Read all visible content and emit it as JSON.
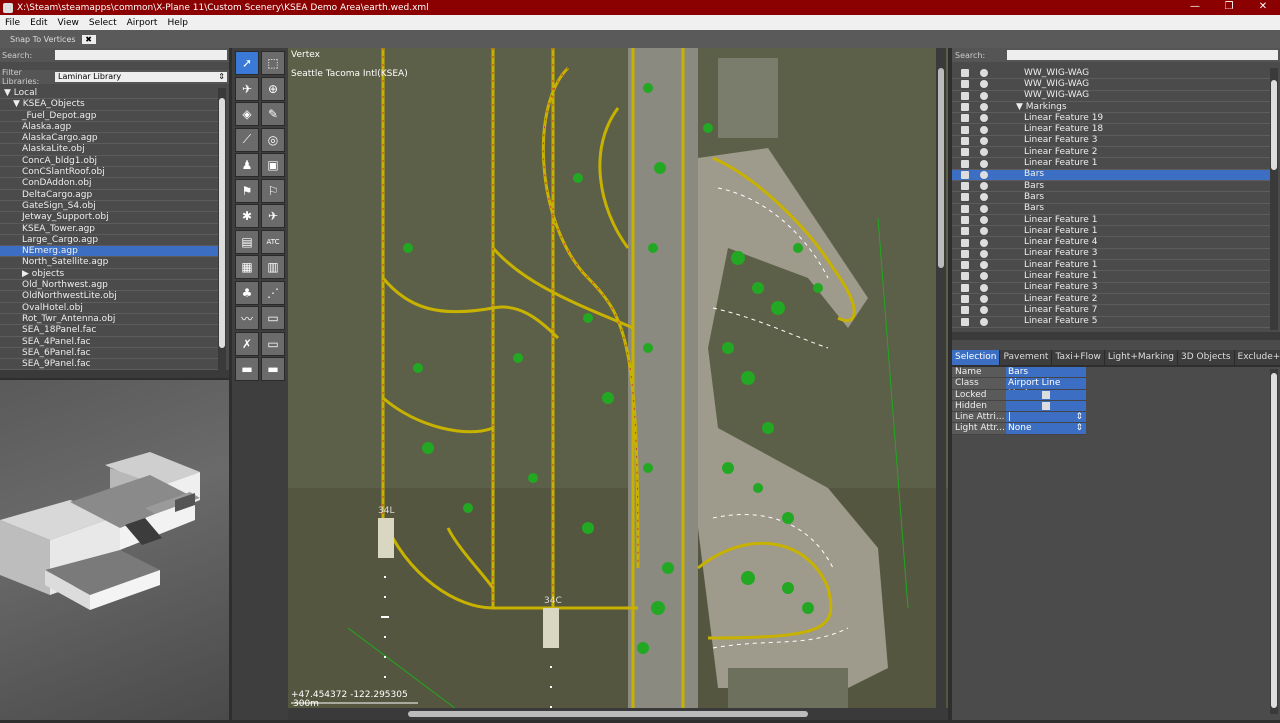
{
  "window": {
    "title": "X:\\Steam\\steamapps\\common\\X-Plane 11\\Custom Scenery\\KSEA Demo Area\\earth.wed.xml",
    "controls": [
      "—",
      "❐",
      "✕"
    ]
  },
  "menu": [
    "File",
    "Edit",
    "View",
    "Select",
    "Airport",
    "Help"
  ],
  "snapbar": {
    "label": "Snap To Vertices",
    "checked": "✖"
  },
  "library": {
    "search_label": "Search:",
    "filter_label": "Filter Libraries:",
    "filter_value": "Laminar Library",
    "tree": [
      {
        "label": "▼ Local",
        "indent": 0
      },
      {
        "label": "▼ KSEA_Objects",
        "indent": 1
      },
      {
        "label": "_Fuel_Depot.agp",
        "indent": 2
      },
      {
        "label": "Alaska.agp",
        "indent": 2
      },
      {
        "label": "AlaskaCargo.agp",
        "indent": 2
      },
      {
        "label": "AlaskaLite.obj",
        "indent": 2
      },
      {
        "label": "ConcA_bldg1.obj",
        "indent": 2
      },
      {
        "label": "ConCSlantRoof.obj",
        "indent": 2
      },
      {
        "label": "ConDAddon.obj",
        "indent": 2
      },
      {
        "label": "DeltaCargo.agp",
        "indent": 2
      },
      {
        "label": "GateSign_S4.obj",
        "indent": 2
      },
      {
        "label": "Jetway_Support.obj",
        "indent": 2
      },
      {
        "label": "KSEA_Tower.agp",
        "indent": 2
      },
      {
        "label": "Large_Cargo.agp",
        "indent": 2
      },
      {
        "label": "NEmerg.agp",
        "indent": 2,
        "selected": true
      },
      {
        "label": "North_Satellite.agp",
        "indent": 2
      },
      {
        "label": "▶ objects",
        "indent": 2
      },
      {
        "label": "Old_Northwest.agp",
        "indent": 2
      },
      {
        "label": "OldNorthwestLite.obj",
        "indent": 2
      },
      {
        "label": "OvalHotel.obj",
        "indent": 2
      },
      {
        "label": "Rot_Twr_Antenna.obj",
        "indent": 2
      },
      {
        "label": "SEA_18Panel.fac",
        "indent": 2
      },
      {
        "label": "SEA_4Panel.fac",
        "indent": 2
      },
      {
        "label": "SEA_6Panel.fac",
        "indent": 2
      },
      {
        "label": "SEA_9Panel.fac",
        "indent": 2
      }
    ]
  },
  "toolbar": {
    "tools": [
      {
        "name": "vertex-tool-icon",
        "glyph": "➚",
        "active": true
      },
      {
        "name": "marquee-tool-icon",
        "glyph": "⬚"
      },
      {
        "name": "runway-tool-icon",
        "glyph": "✈"
      },
      {
        "name": "helipad-tool-icon",
        "glyph": "⊕"
      },
      {
        "name": "sealane-tool-icon",
        "glyph": "◈"
      },
      {
        "name": "light-fixture-tool-icon",
        "glyph": "✎"
      },
      {
        "name": "taxiway-tool-icon",
        "glyph": "⟋"
      },
      {
        "name": "hole-tool-icon",
        "glyph": "◎"
      },
      {
        "name": "boundary-tool-icon",
        "glyph": "♟"
      },
      {
        "name": "sign-tool-icon",
        "glyph": "▣"
      },
      {
        "name": "startup-tool-icon",
        "glyph": "⚑"
      },
      {
        "name": "windsock-tool-icon",
        "glyph": "⚐"
      },
      {
        "name": "beacon-tool-icon",
        "glyph": "✱"
      },
      {
        "name": "route-tool-icon",
        "glyph": "✈"
      },
      {
        "name": "object-tool-icon",
        "glyph": "▤"
      },
      {
        "name": "atc-tool-icon",
        "glyph": "ATC"
      },
      {
        "name": "facade-tool-icon",
        "glyph": "▦"
      },
      {
        "name": "forest-tool-icon",
        "glyph": "▥"
      },
      {
        "name": "tree-tool-icon",
        "glyph": "♣"
      },
      {
        "name": "string-tool-icon",
        "glyph": "⋰"
      },
      {
        "name": "line-tool-icon",
        "glyph": "〰"
      },
      {
        "name": "polygon-tool-icon",
        "glyph": "▭"
      },
      {
        "name": "exclusion-tool-icon",
        "glyph": "✗"
      },
      {
        "name": "draped-tool-icon",
        "glyph": "▭"
      },
      {
        "name": "truck-tool-icon",
        "glyph": "▬"
      },
      {
        "name": "truck-dest-tool-icon",
        "glyph": "▬"
      }
    ]
  },
  "map": {
    "tool_label": "Vertex",
    "airport_label": "Seattle Tacoma Intl(KSEA)",
    "coords": "+47.454372 -122.295305",
    "scale": "300m",
    "runway_labels": [
      "34L",
      "34C"
    ]
  },
  "hierarchy": {
    "search_label": "Search:",
    "rows": [
      {
        "label": "WW_WIG-WAG",
        "indent": 0
      },
      {
        "label": "WW_WIG-WAG",
        "indent": 0
      },
      {
        "label": "WW_WIG-WAG",
        "indent": 0
      },
      {
        "label": "▼ Markings",
        "indent": -1
      },
      {
        "label": "Linear Feature 19",
        "indent": 0
      },
      {
        "label": "Linear Feature 18",
        "indent": 0
      },
      {
        "label": "Linear Feature 3",
        "indent": 0
      },
      {
        "label": "Linear Feature 2",
        "indent": 0
      },
      {
        "label": "Linear Feature 1",
        "indent": 0
      },
      {
        "label": "Bars",
        "indent": 0,
        "selected": true
      },
      {
        "label": "Bars",
        "indent": 0
      },
      {
        "label": "Bars",
        "indent": 0
      },
      {
        "label": "Bars",
        "indent": 0
      },
      {
        "label": "Linear Feature 1",
        "indent": 0
      },
      {
        "label": "Linear Feature 1",
        "indent": 0
      },
      {
        "label": "Linear Feature 4",
        "indent": 0
      },
      {
        "label": "Linear Feature 3",
        "indent": 0
      },
      {
        "label": "Linear Feature 1",
        "indent": 0
      },
      {
        "label": "Linear Feature 1",
        "indent": 0
      },
      {
        "label": "Linear Feature 3",
        "indent": 0
      },
      {
        "label": "Linear Feature 2",
        "indent": 0
      },
      {
        "label": "Linear Feature 7",
        "indent": 0
      },
      {
        "label": "Linear Feature 5",
        "indent": 0
      }
    ]
  },
  "tabs": [
    {
      "label": "Selection",
      "active": true
    },
    {
      "label": "Pavement"
    },
    {
      "label": "Taxi+Flow"
    },
    {
      "label": "Light+Marking"
    },
    {
      "label": "3D Objects"
    },
    {
      "label": "Exclude+Bounda"
    }
  ],
  "properties": [
    {
      "key": "Name",
      "value": "Bars"
    },
    {
      "key": "Class",
      "value": "Airport Line Mark..."
    },
    {
      "key": "Locked",
      "value": "",
      "checkbox": true
    },
    {
      "key": "Hidden",
      "value": "",
      "checkbox": true
    },
    {
      "key": "Line Attri...",
      "value": "|",
      "dropdown": true
    },
    {
      "key": "Light Attr...",
      "value": "None",
      "dropdown": true
    }
  ],
  "colors": {
    "selection": "#3c6fc4",
    "titlebar": "#8b0000",
    "taxiway": "#d4b800",
    "grass": "#22a822",
    "pavement": "#a09a8c"
  }
}
